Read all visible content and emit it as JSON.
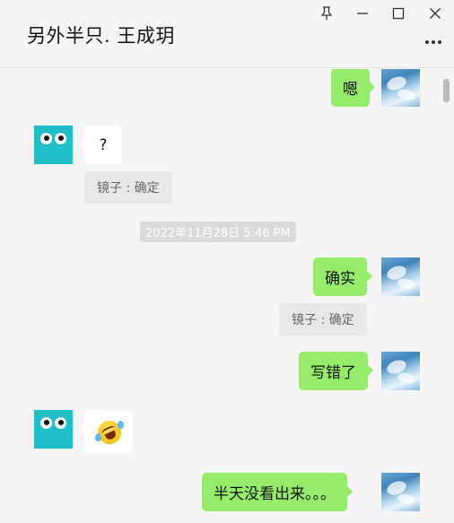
{
  "window": {
    "title": "另外半只. 王成玥",
    "controls": [
      "pin-icon",
      "minimize-icon",
      "maximize-icon",
      "close-icon"
    ],
    "more_icon": "more-dots-icon"
  },
  "messages": [
    {
      "side": "right",
      "text": "嗯"
    },
    {
      "side": "left",
      "text": "?"
    },
    {
      "type": "quote",
      "text": "镜子 : 确定"
    },
    {
      "type": "timestamp",
      "text": "2022年11月28日 5:46 PM"
    },
    {
      "side": "right",
      "text": "确实"
    },
    {
      "type": "quote",
      "text": "镜子 : 确定"
    },
    {
      "side": "right",
      "text": "写错了"
    },
    {
      "side": "left",
      "emoji": "rofl-emoji"
    },
    {
      "side": "right",
      "text": "半天没看出来。。。"
    }
  ],
  "colors": {
    "bubble_self": "#95ec69",
    "bubble_other": "#ffffff",
    "background": "#f5f5f5",
    "quote_bg": "#e8e8e8"
  }
}
